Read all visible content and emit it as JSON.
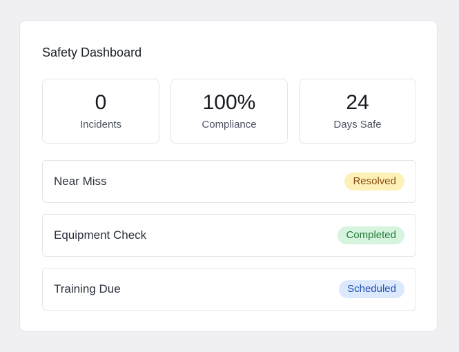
{
  "dashboard": {
    "title": "Safety Dashboard",
    "stats": [
      {
        "value": "0",
        "label": "Incidents"
      },
      {
        "value": "100%",
        "label": "Compliance"
      },
      {
        "value": "24",
        "label": "Days Safe"
      }
    ],
    "items": [
      {
        "label": "Near Miss",
        "status": "Resolved",
        "status_colors": {
          "bg": "#fdf1b8",
          "fg": "#8a4a0f"
        }
      },
      {
        "label": "Equipment Check",
        "status": "Completed",
        "status_colors": {
          "bg": "#d7f4de",
          "fg": "#1f7a3a"
        }
      },
      {
        "label": "Training Due",
        "status": "Scheduled",
        "status_colors": {
          "bg": "#dce8fc",
          "fg": "#1f4fb5"
        }
      }
    ]
  }
}
